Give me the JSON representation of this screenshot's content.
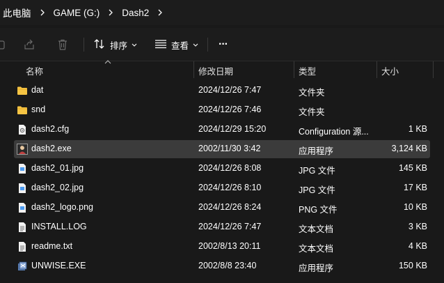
{
  "breadcrumb": {
    "items": [
      "此电脑",
      "GAME (G:)",
      "Dash2"
    ]
  },
  "toolbar": {
    "sort_label": "排序",
    "view_label": "查看",
    "more_label": "···"
  },
  "columns": {
    "name": "名称",
    "date": "修改日期",
    "type": "类型",
    "size": "大小"
  },
  "files": [
    {
      "name": "dat",
      "date": "2024/12/26 7:47",
      "type": "文件夹",
      "size": "",
      "icon": "folder-icon"
    },
    {
      "name": "snd",
      "date": "2024/12/26 7:46",
      "type": "文件夹",
      "size": "",
      "icon": "folder-icon"
    },
    {
      "name": "dash2.cfg",
      "date": "2024/12/29 15:20",
      "type": "Configuration 源...",
      "size": "1 KB",
      "icon": "config-file-icon"
    },
    {
      "name": "dash2.exe",
      "date": "2002/11/30 3:42",
      "type": "应用程序",
      "size": "3,124 KB",
      "icon": "app-icon",
      "selected": true
    },
    {
      "name": "dash2_01.jpg",
      "date": "2024/12/26 8:08",
      "type": "JPG 文件",
      "size": "145 KB",
      "icon": "image-file-icon"
    },
    {
      "name": "dash2_02.jpg",
      "date": "2024/12/26 8:10",
      "type": "JPG 文件",
      "size": "17 KB",
      "icon": "image-file-icon"
    },
    {
      "name": "dash2_logo.png",
      "date": "2024/12/26 8:24",
      "type": "PNG 文件",
      "size": "10 KB",
      "icon": "image-file-icon"
    },
    {
      "name": "INSTALL.LOG",
      "date": "2024/12/26 7:47",
      "type": "文本文档",
      "size": "3 KB",
      "icon": "text-file-icon"
    },
    {
      "name": "readme.txt",
      "date": "2002/8/13 20:11",
      "type": "文本文档",
      "size": "4 KB",
      "icon": "text-file-icon"
    },
    {
      "name": "UNWISE.EXE",
      "date": "2002/8/8 23:40",
      "type": "应用程序",
      "size": "150 KB",
      "icon": "uninstaller-icon"
    }
  ],
  "colors": {
    "background": "#191919",
    "selected_row": "#3b3b3b",
    "folder": "#f6c443",
    "accent": "#4c9bf0"
  }
}
